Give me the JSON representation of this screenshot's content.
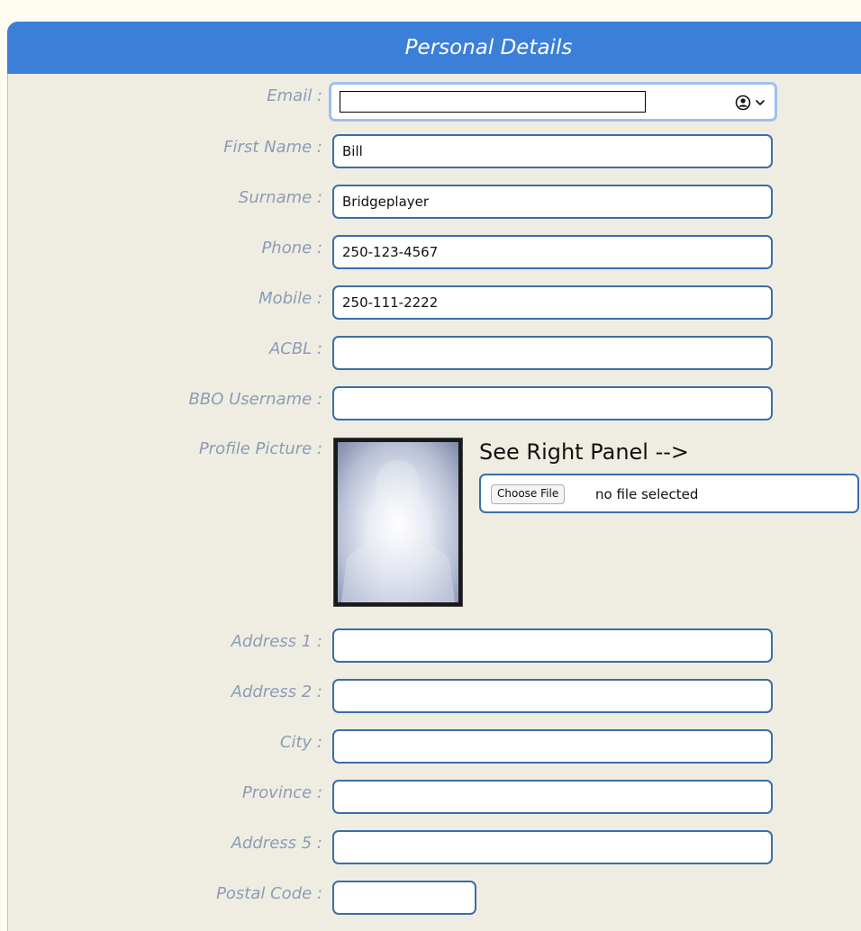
{
  "header": {
    "title": "Personal Details"
  },
  "fields": {
    "email": {
      "label": "Email :",
      "value": ""
    },
    "first_name": {
      "label": "First Name :",
      "value": "Bill"
    },
    "surname": {
      "label": "Surname :",
      "value": "Bridgeplayer"
    },
    "phone": {
      "label": "Phone :",
      "value": "250-123-4567"
    },
    "mobile": {
      "label": "Mobile :",
      "value": "250-111-2222"
    },
    "acbl": {
      "label": "ACBL :",
      "value": ""
    },
    "bbo_username": {
      "label": "BBO Username :",
      "value": ""
    },
    "address1": {
      "label": "Address 1 :",
      "value": ""
    },
    "address2": {
      "label": "Address 2 :",
      "value": ""
    },
    "city": {
      "label": "City :",
      "value": ""
    },
    "province": {
      "label": "Province :",
      "value": ""
    },
    "address5": {
      "label": "Address 5 :",
      "value": ""
    },
    "postal_code": {
      "label": "Postal Code :",
      "value": ""
    }
  },
  "profile_picture": {
    "label": "Profile Picture :",
    "note": "See Right Panel -->",
    "choose_file_label": "Choose File",
    "file_status": "no file selected"
  },
  "icons": {
    "autofill": "person-circle-icon",
    "dropdown": "chevron-down-icon",
    "photo": "silhouette-placeholder"
  },
  "colors": {
    "header": "#3b7fd9",
    "panel": "#efede2",
    "label": "#8b9cb5",
    "field_border": "#3a6ea8"
  }
}
